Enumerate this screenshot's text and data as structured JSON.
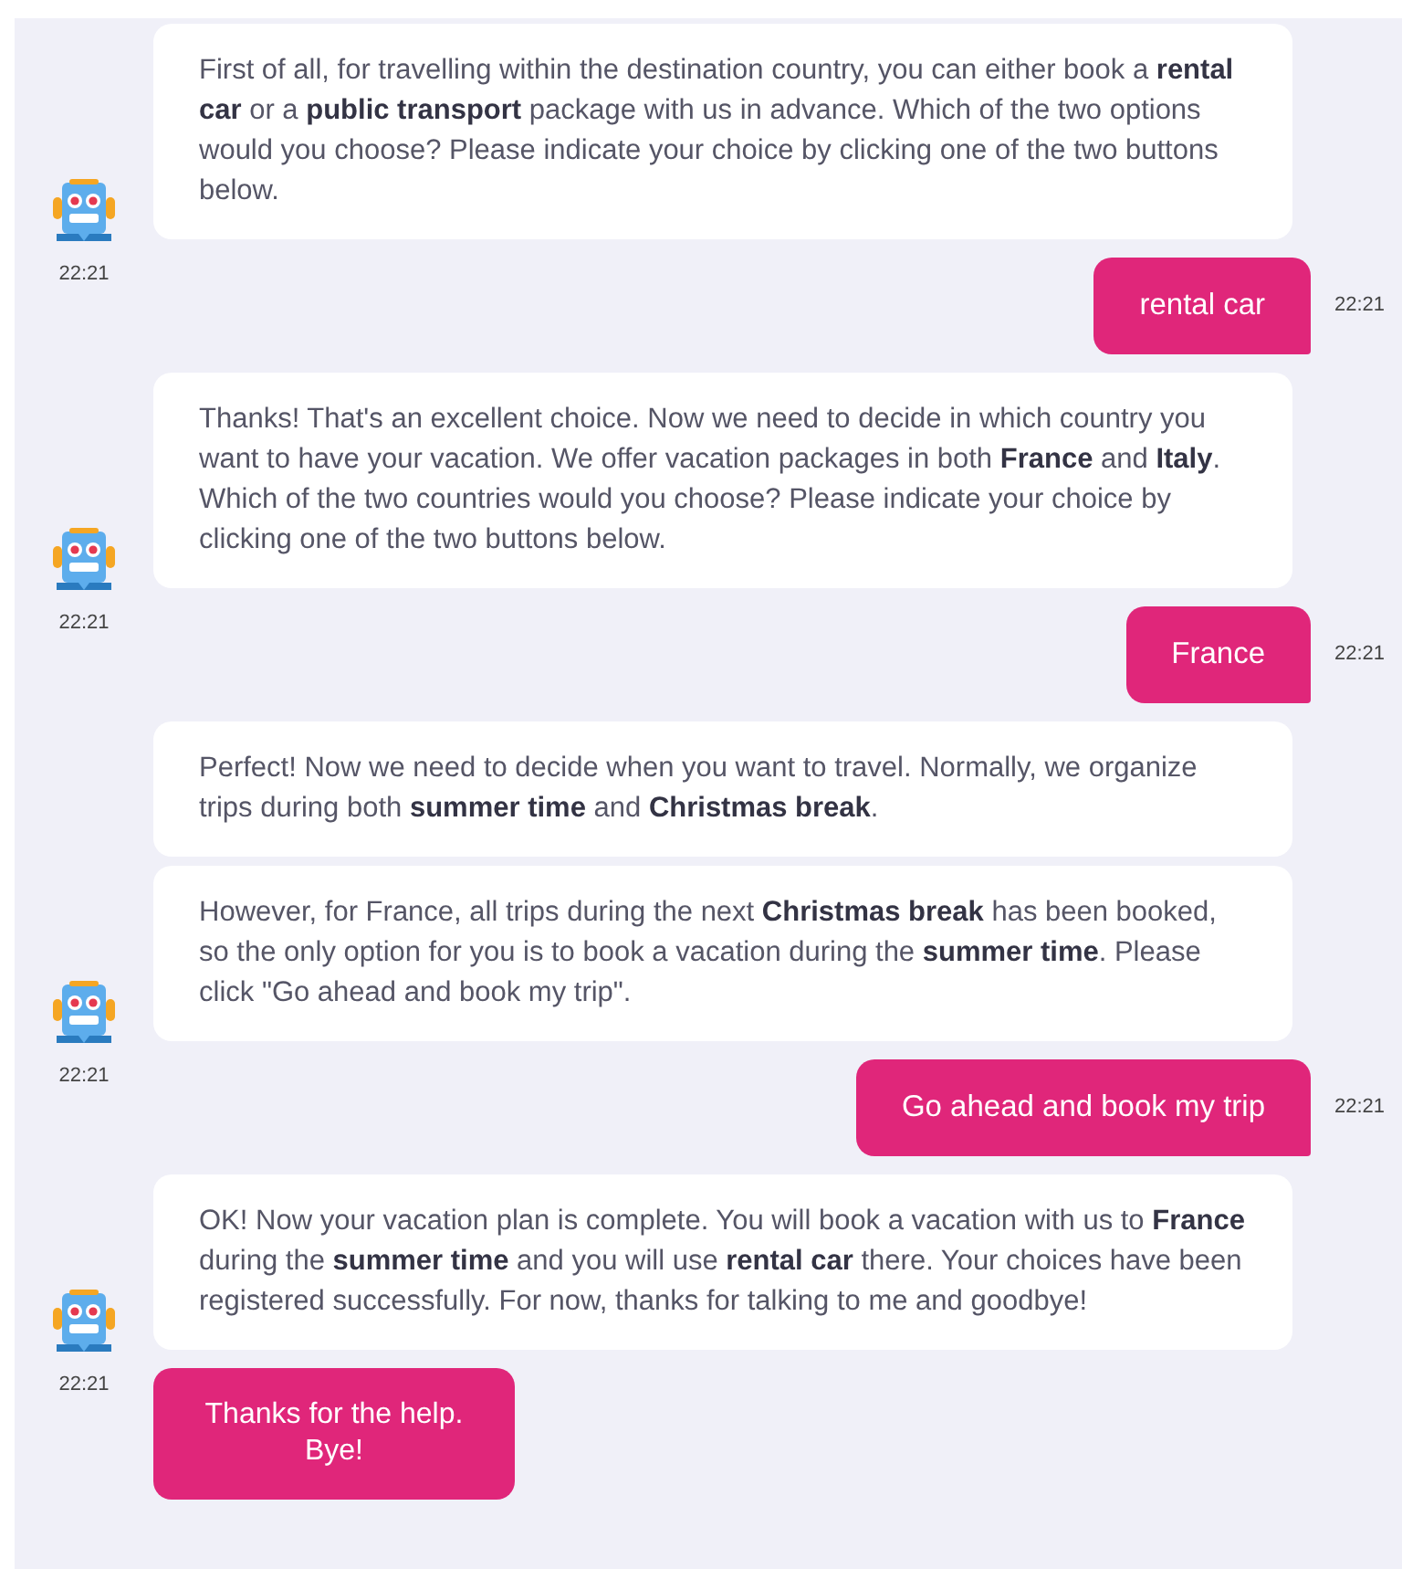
{
  "messages": [
    {
      "kind": "bot",
      "bubbles": [
        "First of all, for travelling within the destination country, you can either book a **rental car** or a **public transport** package with us in advance. Which of the two options would you choose? Please indicate your choice by clicking one of the two buttons below."
      ],
      "time": "22:21"
    },
    {
      "kind": "user",
      "text": "rental car",
      "time": "22:21"
    },
    {
      "kind": "bot",
      "bubbles": [
        "Thanks! That's an excellent choice. Now we need to decide in which country you want to have your vacation. We offer vacation packages in both **France** and **Italy**. Which of the two countries would you choose? Please indicate your choice by clicking one of the two buttons below."
      ],
      "time": "22:21"
    },
    {
      "kind": "user",
      "text": "France",
      "time": "22:21"
    },
    {
      "kind": "bot",
      "bubbles": [
        "Perfect! Now we need to decide when you want to travel. Normally, we organize trips during both **summer time** and **Christmas break**.",
        "However, for France, all trips during the next **Christmas break** has been booked, so the only option for you is to book a vacation during the **summer time**. Please click \"Go ahead and book my trip\"."
      ],
      "time": "22:21"
    },
    {
      "kind": "user",
      "text": "Go ahead and book my trip",
      "time": "22:21"
    },
    {
      "kind": "bot",
      "bubbles": [
        "OK! Now your vacation plan is complete. You will book a vacation with us to **France** during the **summer time** and you will use **rental car** there. Your choices have been registered successfully. For now, thanks for talking to me and goodbye!"
      ],
      "time": "22:21"
    }
  ],
  "quick_replies": [
    "Thanks for the help. Bye!"
  ]
}
